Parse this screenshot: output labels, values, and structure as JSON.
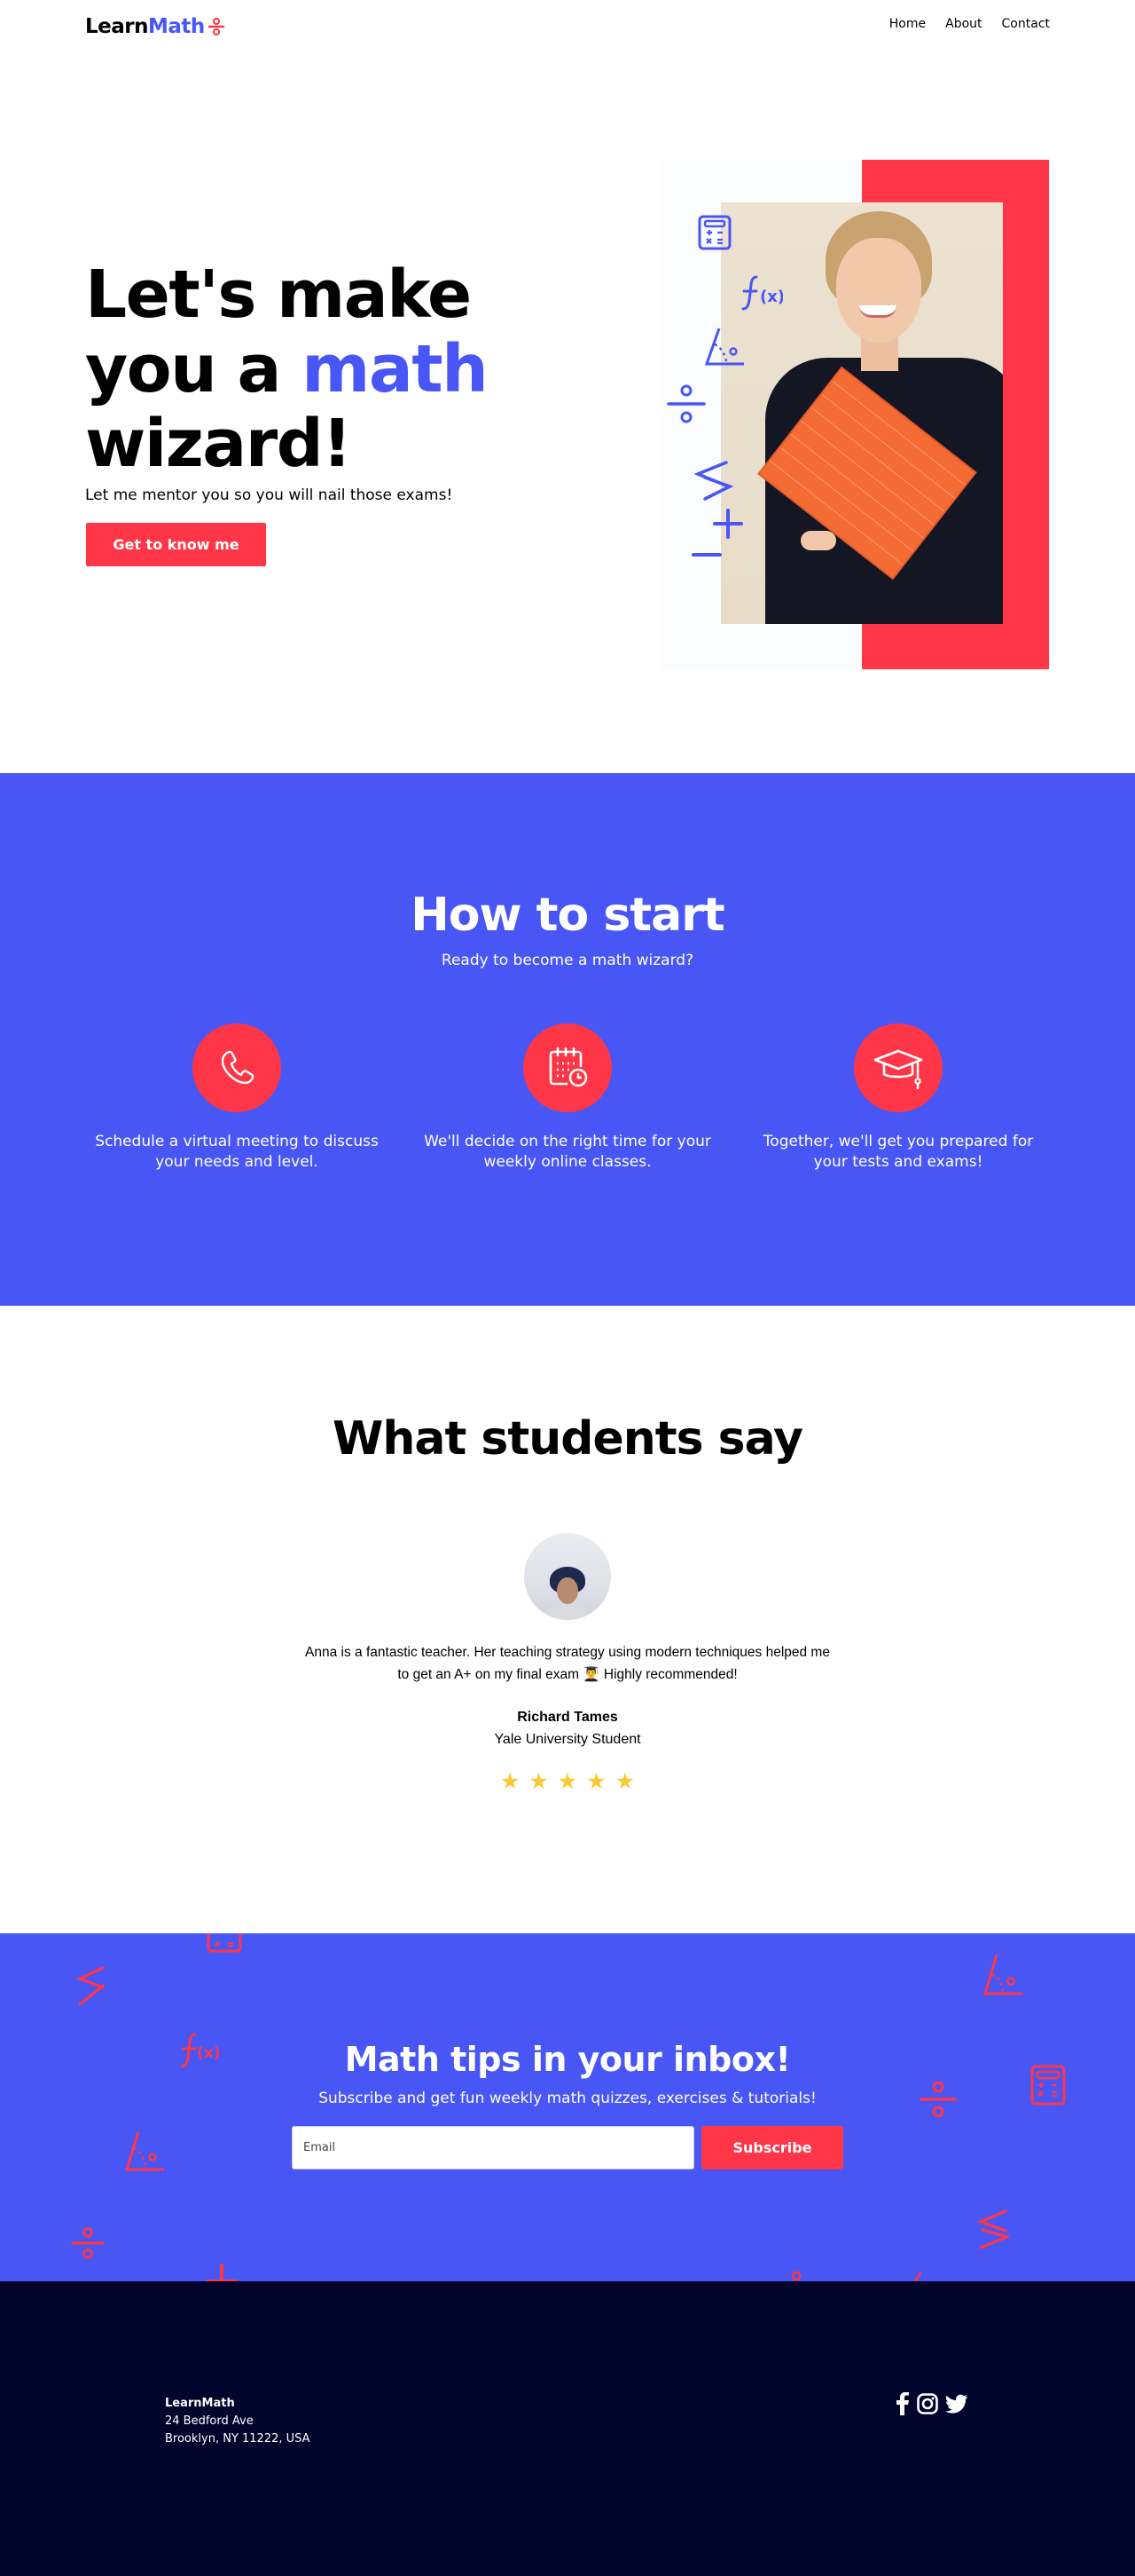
{
  "header": {
    "logo_part1": "Learn",
    "logo_part2": "Math",
    "nav": [
      {
        "label": "Home"
      },
      {
        "label": "About"
      },
      {
        "label": "Contact"
      }
    ]
  },
  "hero": {
    "title_line1": "Let's make",
    "title_line2_prefix": "you a ",
    "title_line2_highlight": "math",
    "title_line3": "wizard!",
    "subtitle": "Let me mentor you so you will nail those exams!",
    "cta_label": "Get to know me",
    "image_alt": "Smiling woman holding an orange notebook",
    "math_icons": [
      "calculator-icon",
      "function-icon",
      "angle-icon",
      "divide-icon",
      "less-greater-icon",
      "plus-icon",
      "minus-icon"
    ]
  },
  "how_to_start": {
    "title": "How to start",
    "subtitle": "Ready to become a math wizard?",
    "steps": [
      {
        "icon": "phone-icon",
        "text": "Schedule a virtual meeting to discuss your needs and level."
      },
      {
        "icon": "calendar-clock-icon",
        "text": "We'll decide on the right time for your weekly online classes."
      },
      {
        "icon": "graduation-cap-icon",
        "text": "Together, we'll get you prepared for your tests and exams!"
      }
    ]
  },
  "testimonials": {
    "title": "What students say",
    "quote": "Anna is a fantastic teacher. Her teaching strategy using modern techniques helped me to get an A+ on my final exam 👨‍🎓 Highly recommended!",
    "author": "Richard Tames",
    "role": "Yale University Student",
    "rating": 5,
    "max_rating": 5
  },
  "newsletter": {
    "title": "Math tips in your inbox!",
    "subtitle": "Subscribe and get fun weekly math quizzes, exercises & tutorials!",
    "email_placeholder": "Email",
    "email_value": "",
    "button_label": "Subscribe"
  },
  "footer": {
    "brand": "LearnMath",
    "address_line1": "24 Bedford Ave",
    "address_line2": "Brooklyn, NY 11222, USA",
    "social": [
      "facebook-icon",
      "instagram-icon",
      "twitter-icon"
    ]
  },
  "colors": {
    "brand_blue": "#4856f6",
    "accent_red": "#ff3647",
    "footer_navy": "#01042b",
    "star_yellow": "#fcc934"
  }
}
